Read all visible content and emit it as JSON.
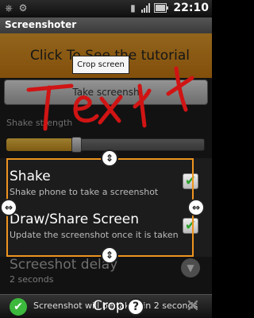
{
  "status_bar": {
    "time": "22:10",
    "icons": [
      "usb-icon",
      "debug-icon",
      "sd-card-icon",
      "signal-icon",
      "battery-icon"
    ]
  },
  "app": {
    "title": "Screenshoter"
  },
  "main": {
    "tutorial_label": "Click To See the tutorial",
    "take_screenshot_label": "Take screensh",
    "shake_strength_label": "Shake strength",
    "shake_strength_value": 0.35,
    "shake": {
      "title": "Shake",
      "subtitle": "Shake phone to take a screenshot",
      "checked": true
    },
    "draw_share": {
      "title": "Draw/Share Screen",
      "subtitle": "Update the screenshot once it is taken",
      "checked": true
    },
    "delay": {
      "title": "Screeshot delay",
      "subtitle": "2 seconds"
    }
  },
  "overlay": {
    "tooltip": "Crop screen",
    "drawn_text": "Tex t",
    "crop_color": "#ee9420",
    "drawing_color": "#d01414"
  },
  "bottom_bar": {
    "toast": "Screenshot will be taken in 2 seconds",
    "crop_label": "Crop",
    "help_symbol": "?",
    "close_symbol": "✕",
    "ok_symbol": "✔"
  }
}
